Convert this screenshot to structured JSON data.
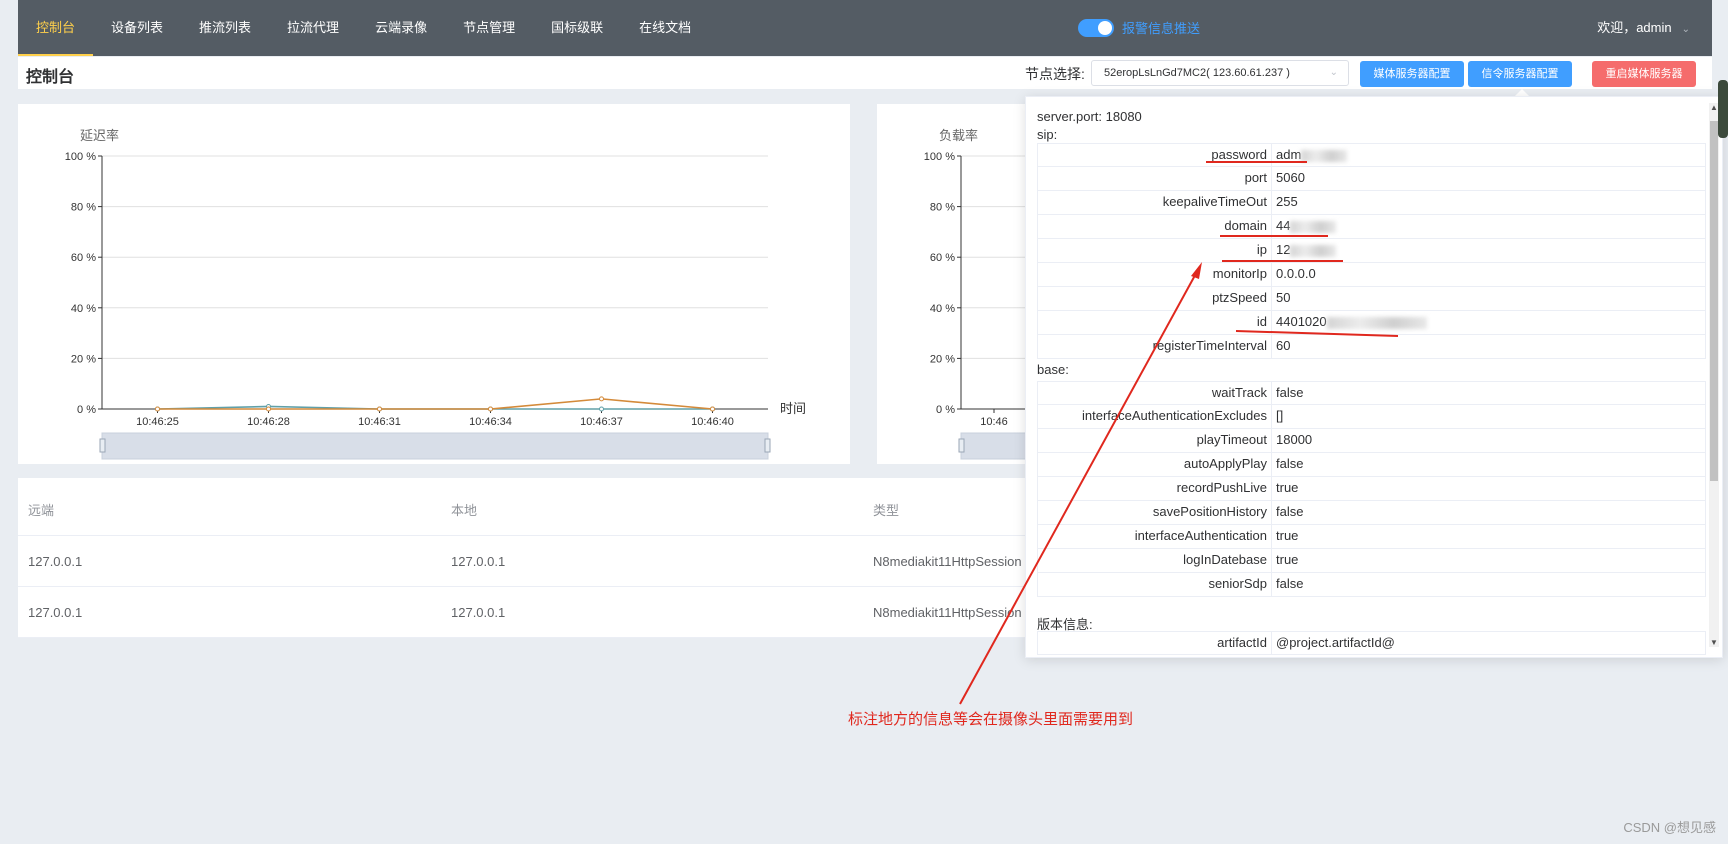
{
  "nav": {
    "items": [
      {
        "label": "控制台",
        "active": true
      },
      {
        "label": "设备列表"
      },
      {
        "label": "推流列表"
      },
      {
        "label": "拉流代理"
      },
      {
        "label": "云端录像"
      },
      {
        "label": "节点管理"
      },
      {
        "label": "国标级联"
      },
      {
        "label": "在线文档"
      }
    ],
    "alarm_label": "报警信息推送",
    "welcome": "欢迎，admin"
  },
  "header": {
    "title": "控制台",
    "node_label": "节点选择:",
    "node_value": "52eropLsLnGd7MC2( 123.60.61.237 )",
    "btn_media": "媒体服务器配置",
    "btn_sip": "信令服务器配置",
    "btn_restart": "重启媒体服务器"
  },
  "chart_data": [
    {
      "type": "line",
      "title": "延迟率",
      "xlabel": "时间",
      "ylabel": "",
      "ylim": [
        0,
        100
      ],
      "yticks": [
        "100 %",
        "80 %",
        "60 %",
        "40 %",
        "20 %",
        "0 %"
      ],
      "categories": [
        "10:46:25",
        "10:46:28",
        "10:46:31",
        "10:46:34",
        "10:46:37",
        "10:46:40"
      ],
      "series": [
        {
          "values": [
            0,
            1,
            0,
            0,
            0,
            0
          ],
          "color": "#61a0a8"
        },
        {
          "values": [
            0,
            0,
            0,
            0,
            4,
            0
          ],
          "color": "#d48a3a"
        }
      ]
    },
    {
      "type": "line",
      "title": "负载率",
      "xlabel": "",
      "ylabel": "",
      "ylim": [
        0,
        100
      ],
      "yticks": [
        "100 %",
        "80 %",
        "60 %",
        "40 %",
        "20 %",
        "0 %"
      ],
      "categories": [
        "10:46"
      ],
      "series": []
    }
  ],
  "table": {
    "headers": [
      "远端",
      "本地",
      "类型"
    ],
    "rows": [
      [
        "127.0.0.1",
        "127.0.0.1",
        "N8mediakit11HttpSession"
      ],
      [
        "127.0.0.1",
        "127.0.0.1",
        "N8mediakit11HttpSession"
      ]
    ]
  },
  "popover": {
    "server_port": "server.port:   18080",
    "sip_label": "sip:",
    "sip": [
      {
        "k": "password",
        "v": "adm"
      },
      {
        "k": "port",
        "v": "5060"
      },
      {
        "k": "keepaliveTimeOut",
        "v": "255"
      },
      {
        "k": "domain",
        "v": "44"
      },
      {
        "k": "ip",
        "v": "12"
      },
      {
        "k": "monitorIp",
        "v": "0.0.0.0"
      },
      {
        "k": "ptzSpeed",
        "v": "50"
      },
      {
        "k": "id",
        "v": "4401020"
      },
      {
        "k": "registerTimeInterval",
        "v": "60"
      }
    ],
    "base_label": "base:",
    "base": [
      {
        "k": "waitTrack",
        "v": "false"
      },
      {
        "k": "interfaceAuthenticationExcludes",
        "v": "[]"
      },
      {
        "k": "playTimeout",
        "v": "18000"
      },
      {
        "k": "autoApplyPlay",
        "v": "false"
      },
      {
        "k": "recordPushLive",
        "v": "true"
      },
      {
        "k": "savePositionHistory",
        "v": "false"
      },
      {
        "k": "interfaceAuthentication",
        "v": "true"
      },
      {
        "k": "logInDatebase",
        "v": "true"
      },
      {
        "k": "seniorSdp",
        "v": "false"
      }
    ],
    "version_label": "版本信息:",
    "version": [
      {
        "k": "artifactId",
        "v": "@project.artifactId@"
      }
    ]
  },
  "annotation": "标注地方的信息等会在摄像头里面需要用到",
  "watermark": "CSDN @想见感"
}
